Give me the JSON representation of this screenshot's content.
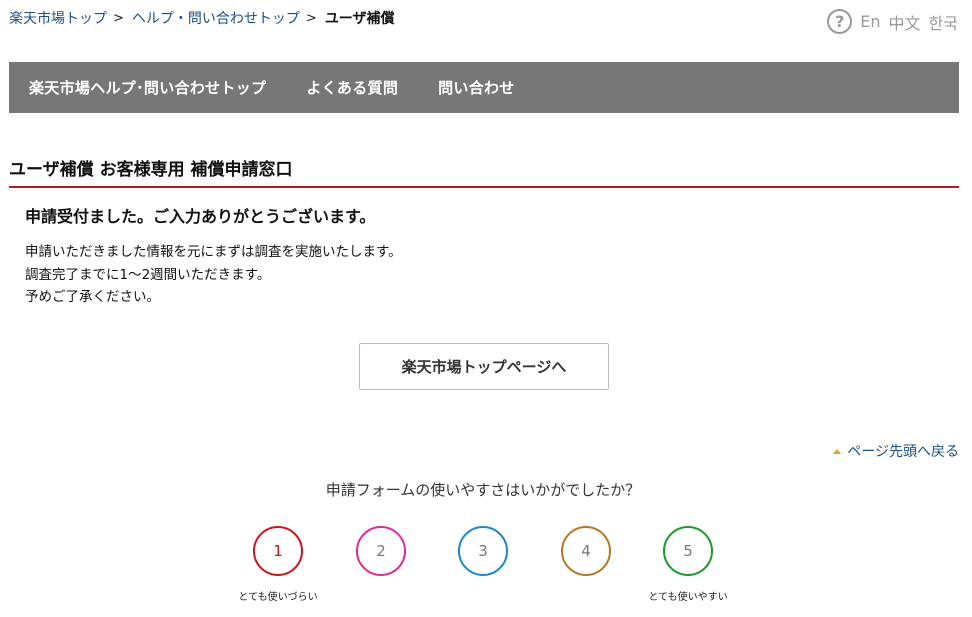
{
  "breadcrumb": {
    "items": [
      "楽天市場トップ",
      "ヘルプ・問い合わせトップ"
    ],
    "separator": ">",
    "current": "ユーザ補償"
  },
  "languages": {
    "help_icon": "question-circle-icon",
    "options": [
      "En",
      "中文",
      "한국"
    ]
  },
  "nav": {
    "items": [
      "楽天市場ヘルプ･問い合わせトップ",
      "よくある質問",
      "問い合わせ"
    ]
  },
  "section_title": "ユーザ補償 お客様専用 補償申請窓口",
  "message": {
    "heading": "申請受付ました。ご入力ありがとうございます。",
    "lines": [
      "申請いただきました情報を元にまずは調査を実施いたします。",
      "調査完了までに1〜2週間いただきます。",
      "予めご了承ください。"
    ]
  },
  "top_button_label": "楽天市場トップページへ",
  "back_to_top": "ページ先頭へ戻る",
  "survey": {
    "question": "申請フォームの使いやすさはいかがでしたか？",
    "ratings": [
      "1",
      "2",
      "3",
      "4",
      "5"
    ],
    "low_label": "とても使いづらい",
    "high_label": "とても使いやすい"
  },
  "colors": {
    "nav_bg": "#777777",
    "title_rule": "#b11a1e",
    "link": "#1a4f87",
    "rating_1": "#d0121b",
    "rating_2": "#e5259a",
    "rating_3": "#1b86c8",
    "rating_4": "#b8771f",
    "rating_5": "#1a9a2a"
  }
}
